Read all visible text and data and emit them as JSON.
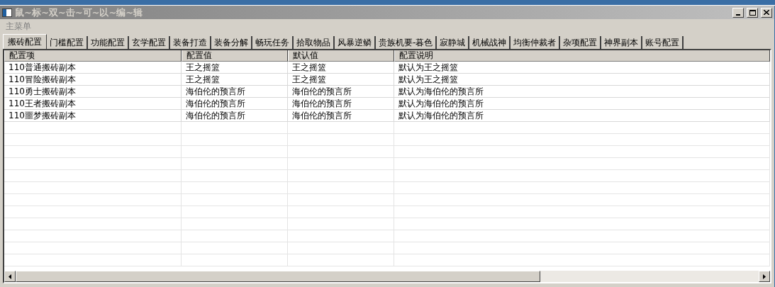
{
  "window": {
    "title": "鼠~标~双~击~可~以~编~辑"
  },
  "menu": [
    "主菜单"
  ],
  "tabs": [
    {
      "label": "搬砖配置",
      "selected": true
    },
    {
      "label": "门槛配置",
      "selected": false
    },
    {
      "label": "功能配置",
      "selected": false
    },
    {
      "label": "玄学配置",
      "selected": false
    },
    {
      "label": "装备打造",
      "selected": false
    },
    {
      "label": "装备分解",
      "selected": false
    },
    {
      "label": "畅玩任务",
      "selected": false
    },
    {
      "label": "拾取物品",
      "selected": false
    },
    {
      "label": "风暴逆鳞",
      "selected": false
    },
    {
      "label": "贵族机要-暮色",
      "selected": false
    },
    {
      "label": "寂静城",
      "selected": false
    },
    {
      "label": "机械战神",
      "selected": false
    },
    {
      "label": "均衡仲裁者",
      "selected": false
    },
    {
      "label": "杂项配置",
      "selected": false
    },
    {
      "label": "神界副本",
      "selected": false
    },
    {
      "label": "账号配置",
      "selected": false
    }
  ],
  "table": {
    "columns": [
      "配置项",
      "配置值",
      "默认值",
      "配置说明"
    ],
    "rows": [
      [
        "110普通搬砖副本",
        "王之摇篮",
        "王之摇篮",
        "默认为王之摇篮"
      ],
      [
        "110冒险搬砖副本",
        "王之摇篮",
        "王之摇篮",
        "默认为王之摇篮"
      ],
      [
        "110勇士搬砖副本",
        "海伯伦的预言所",
        "海伯伦的预言所",
        "默认为海伯伦的预言所"
      ],
      [
        "110王者搬砖副本",
        "海伯伦的预言所",
        "海伯伦的预言所",
        "默认为海伯伦的预言所"
      ],
      [
        "110噩梦搬砖副本",
        "海伯伦的预言所",
        "海伯伦的预言所",
        "默认为海伯伦的预言所"
      ]
    ]
  }
}
